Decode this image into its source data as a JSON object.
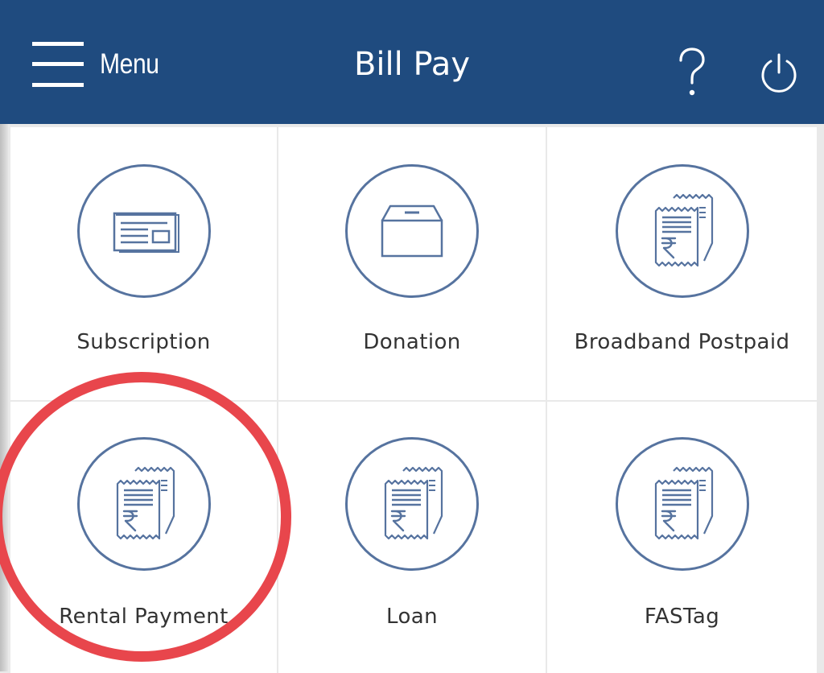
{
  "header": {
    "menu_label": "Menu",
    "title": "Bill Pay",
    "help_glyph": "?",
    "menu_icon": "hamburger-icon",
    "help_icon": "question-mark-icon",
    "power_icon": "power-icon",
    "background": "#1f4b7f"
  },
  "tiles": [
    {
      "label": "Subscription",
      "icon": "newspaper-icon"
    },
    {
      "label": "Donation",
      "icon": "donation-box-icon"
    },
    {
      "label": "Broadband Postpaid",
      "icon": "rupee-bill-icon"
    },
    {
      "label": "Rental Payment",
      "icon": "rupee-bill-icon",
      "highlighted": true
    },
    {
      "label": "Loan",
      "icon": "rupee-bill-icon"
    },
    {
      "label": "FASTag",
      "icon": "rupee-bill-icon"
    }
  ],
  "colors": {
    "icon_stroke": "#56739f",
    "highlight_ring": "#e8464c",
    "tile_background": "#ffffff"
  }
}
